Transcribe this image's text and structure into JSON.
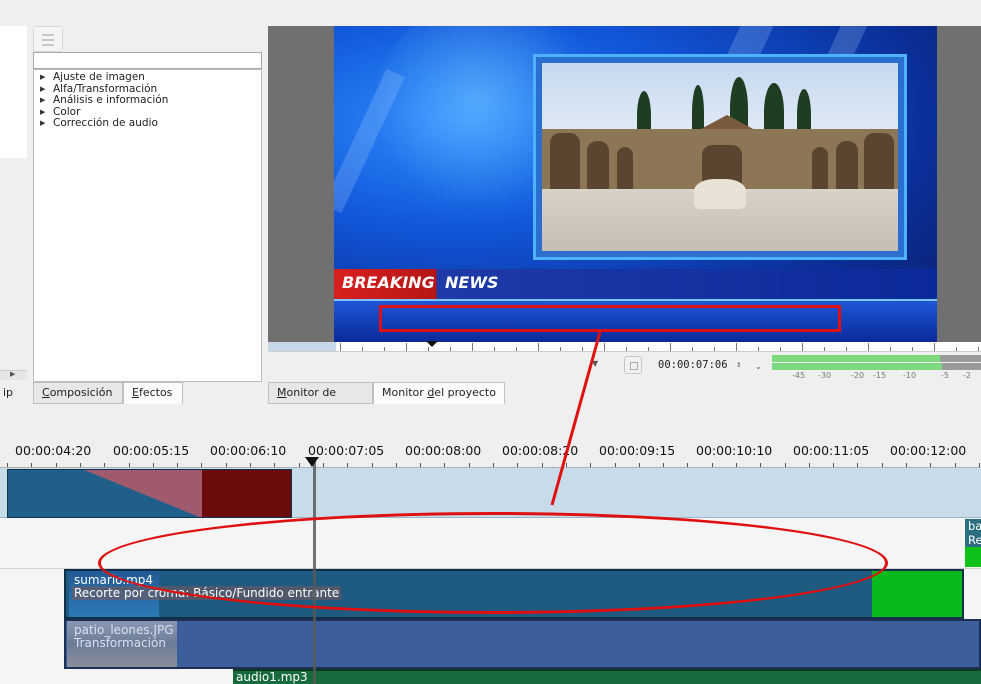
{
  "effects_panel": {
    "categories": [
      "Ajuste de imagen",
      "Alfa/Transformación",
      "Análisis e información",
      "Color",
      "Corrección de audio"
    ],
    "left_tab_fragment": "ip"
  },
  "bottom_tabs_left": [
    {
      "label": "Composición",
      "accel": "C",
      "rest": "omposición",
      "active": false
    },
    {
      "label": "Efectos",
      "accel": "E",
      "rest": "fectos",
      "active": true
    }
  ],
  "bottom_tabs_monitor": [
    {
      "label": "Monitor de clips",
      "accel": "M",
      "rest": "onitor de clips",
      "active": false
    },
    {
      "label": "Monitor del proyecto",
      "pre": "Monitor ",
      "accel": "d",
      "rest": "el proyecto",
      "active": true
    }
  ],
  "monitor": {
    "breaking": "BREAKING",
    "news": "NEWS",
    "timecode": "00:00:07:06",
    "spin_icon": "spinner-arrows-icon",
    "meter_scale": [
      "-45",
      "-30",
      "-20",
      "-15",
      "-10",
      "-5",
      "-2"
    ]
  },
  "timeline": {
    "ruler_labels": [
      "00:00:04:20",
      "00:00:05:15",
      "00:00:06:10",
      "00:00:07:05",
      "00:00:08:00",
      "00:00:08:20",
      "00:00:09:15",
      "00:00:10:10",
      "00:00:11:05",
      "00:00:12:00"
    ],
    "clips": {
      "right_green": {
        "title": "ba",
        "sub": "Re"
      },
      "sumario": {
        "title": "sumario.mp4",
        "sub": "Recorte por croma: Básico/Fundido entrante"
      },
      "patio": {
        "title": "patio_leones.JPG",
        "sub": "Transformación"
      },
      "audio": {
        "title": "audio1.mp3"
      }
    }
  },
  "colors": {
    "annotation": "#e01010",
    "video_clip": "#1f5a80",
    "image_clip": "#3c5f9c",
    "audio_clip": "#186b3c",
    "transition_green": "#07b91c"
  }
}
